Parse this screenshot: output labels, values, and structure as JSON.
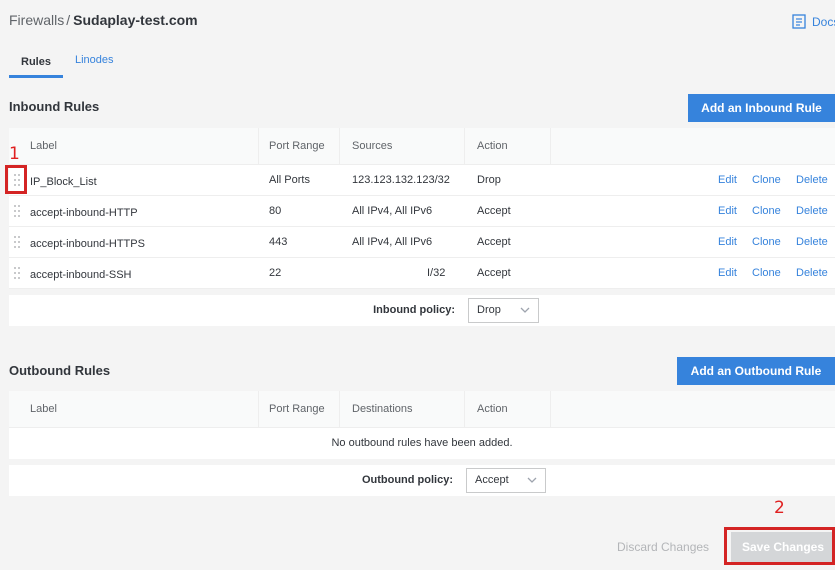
{
  "breadcrumb": {
    "parent": "Firewalls",
    "separator": "/",
    "current": "Sudaplay-test.com"
  },
  "docs": {
    "label": "Docs",
    "icon": "document-icon"
  },
  "tabs": [
    {
      "label": "Rules",
      "active": true
    },
    {
      "label": "Linodes",
      "active": false
    }
  ],
  "inbound": {
    "title": "Inbound Rules",
    "add_button": "Add an Inbound Rule",
    "columns": [
      "Label",
      "Port Range",
      "Sources",
      "Action"
    ],
    "rows": [
      {
        "label": "IP_Block_List",
        "port": "All Ports",
        "sources": "123.123.132.123/32",
        "action": "Drop"
      },
      {
        "label": "accept-inbound-HTTP",
        "port": "80",
        "sources": "All IPv4, All IPv6",
        "action": "Accept"
      },
      {
        "label": "accept-inbound-HTTPS",
        "port": "443",
        "sources": "All IPv4, All IPv6",
        "action": "Accept"
      },
      {
        "label": "accept-inbound-SSH",
        "port": "22",
        "sources": "I/32",
        "action": "Accept"
      }
    ],
    "row_actions": {
      "edit": "Edit",
      "clone": "Clone",
      "delete": "Delete"
    },
    "policy_label": "Inbound policy:",
    "policy_value": "Drop"
  },
  "outbound": {
    "title": "Outbound Rules",
    "add_button": "Add an Outbound Rule",
    "columns": [
      "Label",
      "Port Range",
      "Destinations",
      "Action"
    ],
    "empty_message": "No outbound rules have been added.",
    "policy_label": "Outbound policy:",
    "policy_value": "Accept"
  },
  "footer": {
    "discard": "Discard Changes",
    "save": "Save Changes"
  },
  "annotations": {
    "marker_1": "1",
    "marker_2": "2"
  },
  "colors": {
    "accent": "#3683dc",
    "annotation": "#d42424",
    "disabled_button": "#d4d6d8"
  }
}
